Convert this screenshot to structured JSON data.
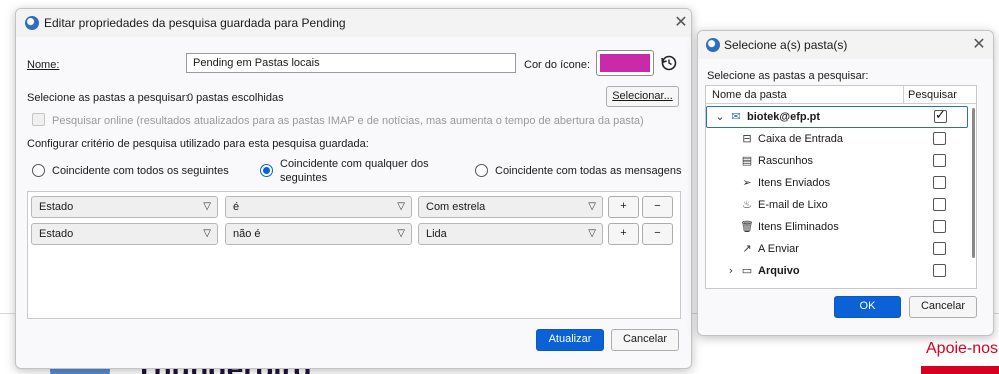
{
  "background": {
    "brand_text": "Thunderbird",
    "support_text": "Apoie-nos"
  },
  "main_dialog": {
    "title": "Editar propriedades da pesquisa guardada para Pending",
    "name_label": "Nome:",
    "name_value": "Pending em Pastas locais",
    "icon_color_label": "Cor do ícone:",
    "icon_color": "#c82aa9",
    "folders_label": "Selecione as pastas a pesquisar:",
    "folders_value": "0 pastas escolhidas",
    "select_button": "Selecionar...",
    "online_label": "Pesquisar online (resultados atualizados para as pastas IMAP e de notícias, mas aumenta o tempo de abertura da pasta)",
    "criteria_label": "Configurar critério de pesquisa utilizado para esta pesquisa guardada:",
    "radio_all": "Coincidente com todos os seguintes",
    "radio_any_line1": "Coincidente com qualquer dos",
    "radio_any_line2": "seguintes",
    "radio_every_message": "Coincidente com todas as mensagens",
    "rules": [
      {
        "field": "Estado",
        "operator": "é",
        "value": "Com estrela",
        "add": "+",
        "remove": "−"
      },
      {
        "field": "Estado",
        "operator": "não é",
        "value": "Lida",
        "add": "+",
        "remove": "−"
      }
    ],
    "update_button": "Atualizar",
    "cancel_button": "Cancelar"
  },
  "folder_dialog": {
    "title": "Selecione a(s) pasta(s)",
    "instruction": "Selecione as pastas a pesquisar:",
    "col_folder": "Nome da pasta",
    "col_search": "Pesquisar",
    "account": "biotek@efp.pt",
    "folders": [
      {
        "name": "Caixa de Entrada",
        "icon": "inbox-icon"
      },
      {
        "name": "Rascunhos",
        "icon": "drafts-icon"
      },
      {
        "name": "Itens Enviados",
        "icon": "sent-icon"
      },
      {
        "name": "E-mail de Lixo",
        "icon": "junk-icon"
      },
      {
        "name": "Itens Eliminados",
        "icon": "trash-icon"
      },
      {
        "name": "A Enviar",
        "icon": "outbox-icon"
      },
      {
        "name": "Arquivo",
        "icon": "folder-icon"
      }
    ],
    "ok_button": "OK",
    "cancel_button": "Cancelar"
  },
  "colors": {
    "accent": "#0b61d6",
    "icon_color": "#c82aa9"
  }
}
